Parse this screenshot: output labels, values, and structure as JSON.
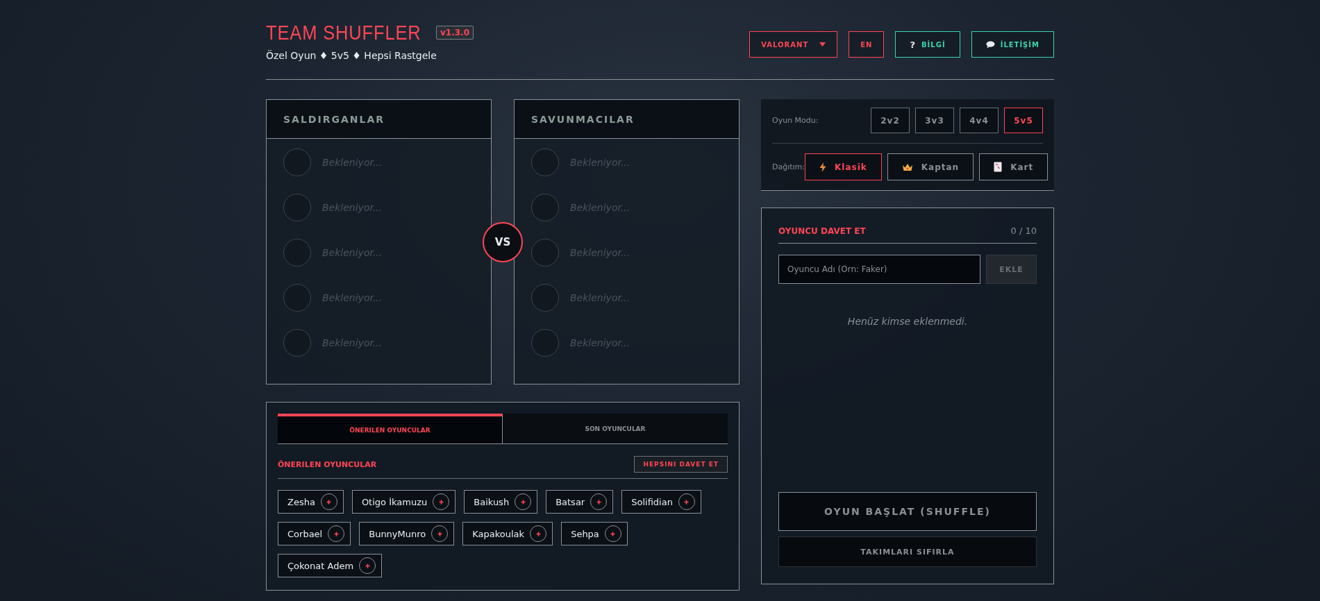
{
  "header": {
    "title": "TEAM SHUFFLER",
    "version": "v1.3.0",
    "subtitle": "Özel Oyun ♦ 5v5 ♦ Hepsi Rastgele"
  },
  "header_buttons": [
    {
      "kind": "dropdown",
      "label": "VALORANT"
    },
    {
      "kind": "plain",
      "label": "EN"
    },
    {
      "kind": "info",
      "icon": "?",
      "label": "BİLGİ"
    },
    {
      "kind": "contact",
      "label": "İLETİŞİM"
    }
  ],
  "teams": [
    {
      "name": "SALDIRGANLAR",
      "slots": [
        "Bekleniyor...",
        "Bekleniyor...",
        "Bekleniyor...",
        "Bekleniyor...",
        "Bekleniyor..."
      ]
    },
    {
      "name": "SAVUNMACILAR",
      "slots": [
        "Bekleniyor...",
        "Bekleniyor...",
        "Bekleniyor...",
        "Bekleniyor...",
        "Bekleniyor..."
      ]
    }
  ],
  "vs": "VS",
  "settings": {
    "mode_label": "Oyun Modu:",
    "modes": [
      {
        "label": "2v2",
        "selected": false
      },
      {
        "label": "3v3",
        "selected": false
      },
      {
        "label": "4v4",
        "selected": false
      },
      {
        "label": "5v5",
        "selected": true
      }
    ],
    "distribution_label": "Dağıtım:",
    "distributions": [
      {
        "kind": "lightning",
        "label": "Klasik",
        "selected": true
      },
      {
        "kind": "crown",
        "label": "Kaptan",
        "selected": false
      },
      {
        "kind": "card",
        "label": "Kart",
        "selected": false
      }
    ]
  },
  "invite": {
    "title": "OYUNCU DAVET ET",
    "count": "0 / 10",
    "placeholder": "Oyuncu Adı (Örn: Faker)",
    "add_button": "EKLE",
    "empty_text": "Henüz kimse eklenmedi.",
    "start_button": "OYUN BAŞLAT (SHUFFLE)",
    "reset_button": "TAKIMLARI SIFIRLA"
  },
  "suggestions": {
    "tabs": [
      {
        "label": "ÖNERILEN OYUNCULAR",
        "selected": true
      },
      {
        "label": "SON OYUNCULAR",
        "selected": false
      }
    ],
    "section_title": "ÖNERILEN OYUNCULAR",
    "invite_all": "HEPSINI DAVET ET",
    "players": [
      "Zesha",
      "Otigo İkamuzu",
      "Baikush",
      "Batsar",
      "Solifidian",
      "Corbael",
      "BunnyMunro",
      "Kapakoulak",
      "Sehpa",
      "Çokonat Adem"
    ]
  }
}
